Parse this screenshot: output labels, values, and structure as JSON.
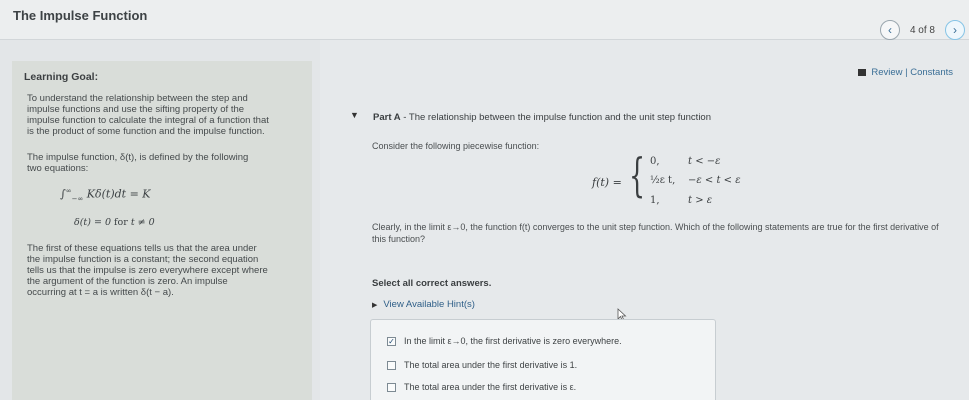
{
  "app": {
    "title": "The Impulse Function"
  },
  "nav": {
    "prev_icon": "‹",
    "next_icon": "›",
    "page": "4 of 8"
  },
  "learning_goal": {
    "heading": "Learning Goal:",
    "para1": [
      "To understand the relationship between the step and",
      "impulse functions and use the sifting property of the",
      "impulse function to calculate the integral of a function that",
      "is the product of some function and the impulse function."
    ],
    "para2": [
      "The impulse function, δ(t), is defined by the following",
      "two equations:"
    ],
    "eq1": {
      "int": "∫",
      "upper": "∞",
      "lower": "−∞",
      "body": "Kδ(t)dt = K"
    },
    "eq2": {
      "lhs": "δ(t) = 0",
      "for": " for ",
      "cond": "t ≠ 0"
    },
    "para3": [
      "The first of these equations tells us that the area under",
      "the impulse function is a constant; the second equation",
      "tells us that the impulse is zero everywhere except where",
      "the argument of the function is zero. An impulse",
      "occurring at t = a is written δ(t − a)."
    ]
  },
  "header_links": {
    "review": "Review | Constants"
  },
  "part_a": {
    "label": "Part A",
    "title": " - The relationship between the impulse function and the unit step function",
    "consider": "Consider the following piecewise function:",
    "function": {
      "lhs": "f(t) =",
      "rows": [
        {
          "value": "0,",
          "condition": "t < −ε"
        },
        {
          "value": "½ε t,",
          "condition": "−ε < t < ε"
        },
        {
          "value": "1,",
          "condition": "t > ε"
        }
      ]
    },
    "clearly": "Clearly, in the limit ε→0, the function f(t) converges to the unit step function. Which of the following statements are true for the first derivative of this function?",
    "select": "Select all correct answers.",
    "hint": "View Available Hint(s)",
    "options": [
      {
        "text": "In the limit ε→0, the first derivative is zero everywhere.",
        "checked": true
      },
      {
        "text": "The total area under the first derivative is 1.",
        "checked": false
      },
      {
        "text": "The total area under the first derivative is ε.",
        "checked": false
      }
    ]
  }
}
